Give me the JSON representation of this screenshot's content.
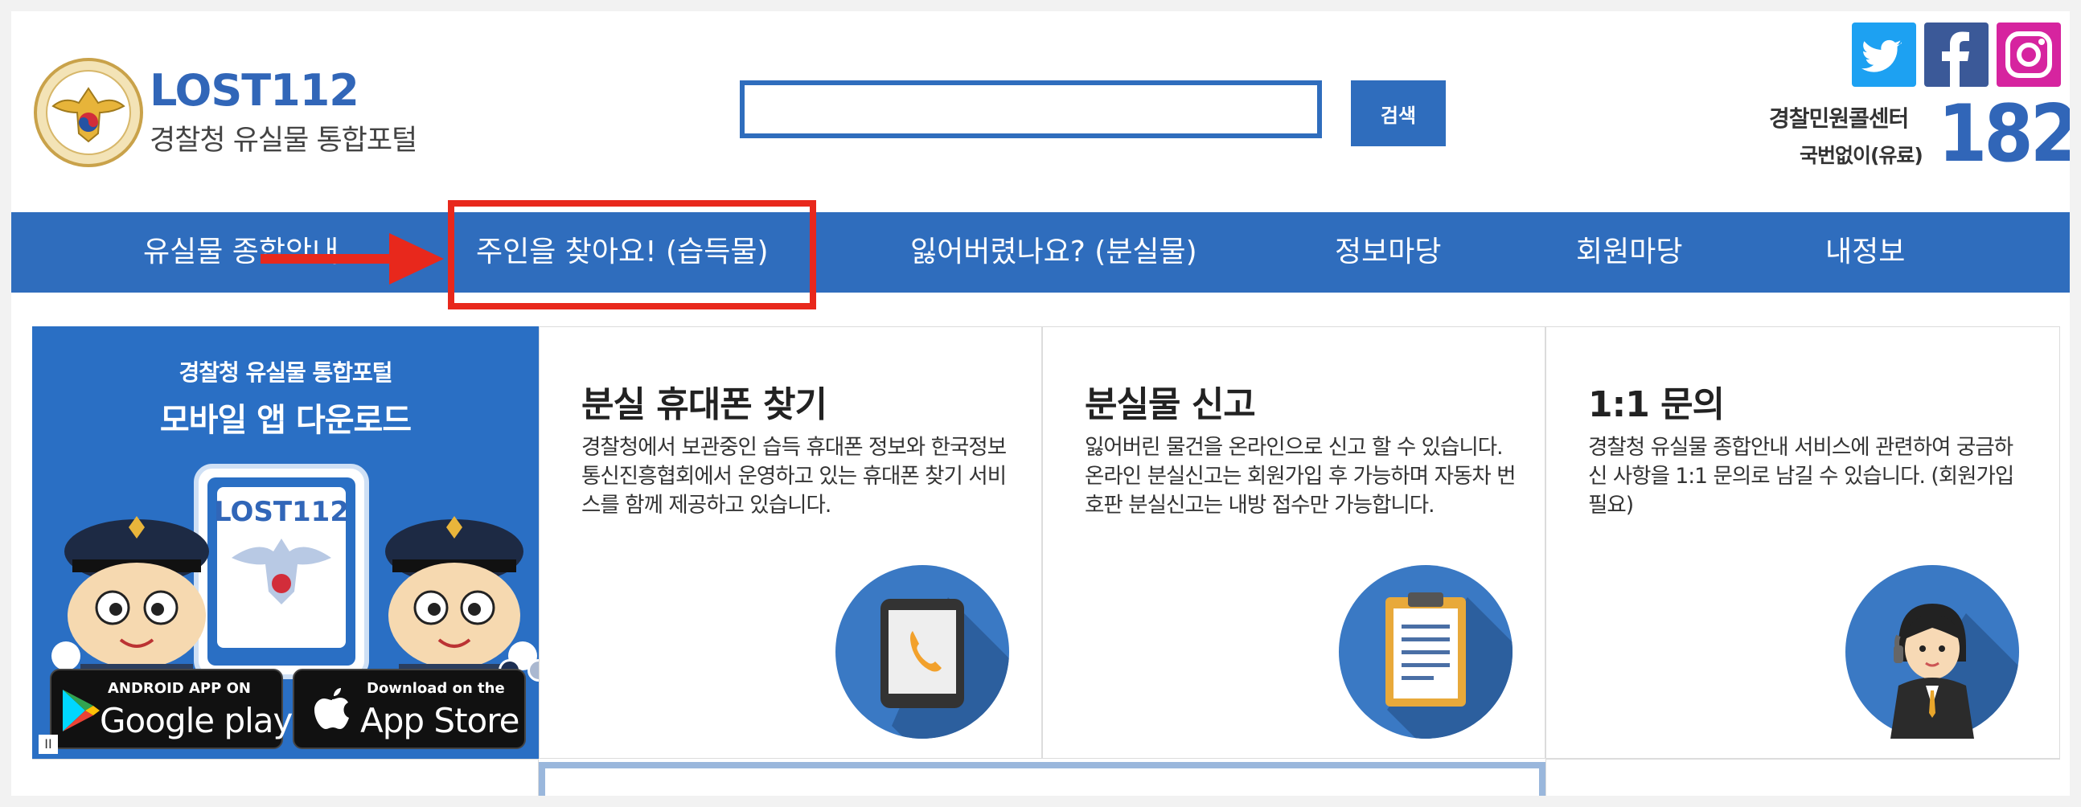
{
  "header": {
    "brand_title": "LOST112",
    "brand_subtitle": "경찰청 유실물 통합포털",
    "search": {
      "value": "",
      "placeholder": "",
      "button_label": "검색"
    },
    "social": [
      "twitter-icon",
      "facebook-icon",
      "instagram-icon"
    ],
    "call_center": {
      "label": "경찰민원콜센터",
      "note": "국번없이(유료)",
      "number": "182"
    }
  },
  "nav": {
    "items": [
      {
        "label": "유실물 종합안내"
      },
      {
        "label": "주인을 찾아요! (습득물)"
      },
      {
        "label": "잃어버렸나요? (분실물)"
      },
      {
        "label": "정보마당"
      },
      {
        "label": "회원마당"
      },
      {
        "label": "내정보"
      }
    ],
    "highlight_color": "#e8281c",
    "bar_color": "#2f6dbd"
  },
  "banner": {
    "subtitle": "경찰청 유실물 통합포털",
    "title": "모바일 앱 다운로드",
    "phone_brand": "LOST112",
    "google_play": {
      "small": "ANDROID APP ON",
      "big": "Google play"
    },
    "app_store": {
      "small": "Download on the",
      "big": "App Store"
    },
    "pause_label": "II"
  },
  "cards": [
    {
      "title": "분실 휴대폰 찾기",
      "desc": "경찰청에서 보관중인 습득 휴대폰 정보와 한국정보통신진흥협회에서 운영하고 있는 휴대폰 찾기 서비스를 함께 제공하고 있습니다.",
      "icon": "phone-icon"
    },
    {
      "title": "분실물 신고",
      "desc": "잃어버린 물건을 온라인으로 신고 할 수 있습니다. 온라인 분실신고는 회원가입 후 가능하며 자동차 번호판 분실신고는 내방 접수만 가능합니다.",
      "icon": "clipboard-icon"
    },
    {
      "title": "1:1 문의",
      "desc": "경찰청 유실물 종합안내 서비스에 관련하여 궁금하신 사항을 1:1 문의로 남길 수 있습니다. (회원가입 필요)",
      "icon": "operator-icon"
    }
  ]
}
